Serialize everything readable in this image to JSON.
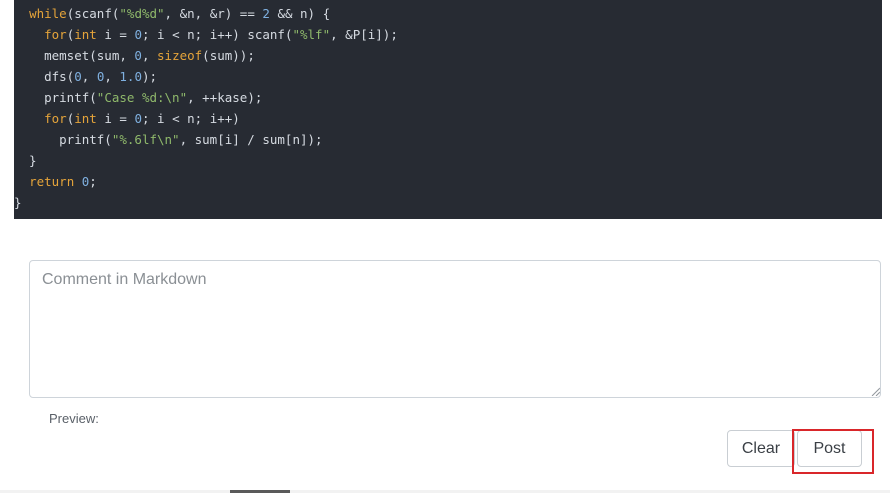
{
  "code": {
    "lines": [
      [
        [
          "  ",
          "plain"
        ],
        [
          "while",
          "keyword"
        ],
        [
          "(scanf(",
          "plain"
        ],
        [
          "\"%d%d\"",
          "string"
        ],
        [
          ", &n, &r) == ",
          "plain"
        ],
        [
          "2",
          "number"
        ],
        [
          " && n) {",
          "plain"
        ]
      ],
      [
        [
          "    ",
          "plain"
        ],
        [
          "for",
          "keyword"
        ],
        [
          "(",
          "plain"
        ],
        [
          "int",
          "keyword"
        ],
        [
          " i = ",
          "plain"
        ],
        [
          "0",
          "number"
        ],
        [
          "; i < n; i++) scanf(",
          "plain"
        ],
        [
          "\"%lf\"",
          "string"
        ],
        [
          ", &P[i]);",
          "plain"
        ]
      ],
      [
        [
          "    memset(sum, ",
          "plain"
        ],
        [
          "0",
          "number"
        ],
        [
          ", ",
          "plain"
        ],
        [
          "sizeof",
          "keyword"
        ],
        [
          "(sum));",
          "plain"
        ]
      ],
      [
        [
          "    dfs(",
          "plain"
        ],
        [
          "0",
          "number"
        ],
        [
          ", ",
          "plain"
        ],
        [
          "0",
          "number"
        ],
        [
          ", ",
          "plain"
        ],
        [
          "1.0",
          "number"
        ],
        [
          ");",
          "plain"
        ]
      ],
      [
        [
          "    printf(",
          "plain"
        ],
        [
          "\"Case %d:\\n\"",
          "string"
        ],
        [
          ", ++kase);",
          "plain"
        ]
      ],
      [
        [
          "    ",
          "plain"
        ],
        [
          "for",
          "keyword"
        ],
        [
          "(",
          "plain"
        ],
        [
          "int",
          "keyword"
        ],
        [
          " i = ",
          "plain"
        ],
        [
          "0",
          "number"
        ],
        [
          "; i < n; i++)",
          "plain"
        ]
      ],
      [
        [
          "      printf(",
          "plain"
        ],
        [
          "\"%.6lf\\n\"",
          "string"
        ],
        [
          ", sum[i] / sum[n]);",
          "plain"
        ]
      ],
      [
        [
          "  }",
          "plain"
        ]
      ],
      [
        [
          "  ",
          "plain"
        ],
        [
          "return",
          "keyword"
        ],
        [
          " ",
          "plain"
        ],
        [
          "0",
          "number"
        ],
        [
          ";",
          "plain"
        ]
      ],
      [
        [
          "}",
          "plain"
        ]
      ]
    ]
  },
  "comment": {
    "placeholder": "Comment in Markdown",
    "value": ""
  },
  "preview": {
    "label": "Preview:"
  },
  "buttons": {
    "clear_label": "Clear",
    "post_label": "Post"
  },
  "colors": {
    "code_background": "#272b33",
    "keyword": "#e5a43a",
    "string": "#8fb96b",
    "number": "#7fb0e0",
    "highlight": "#d9262a"
  }
}
